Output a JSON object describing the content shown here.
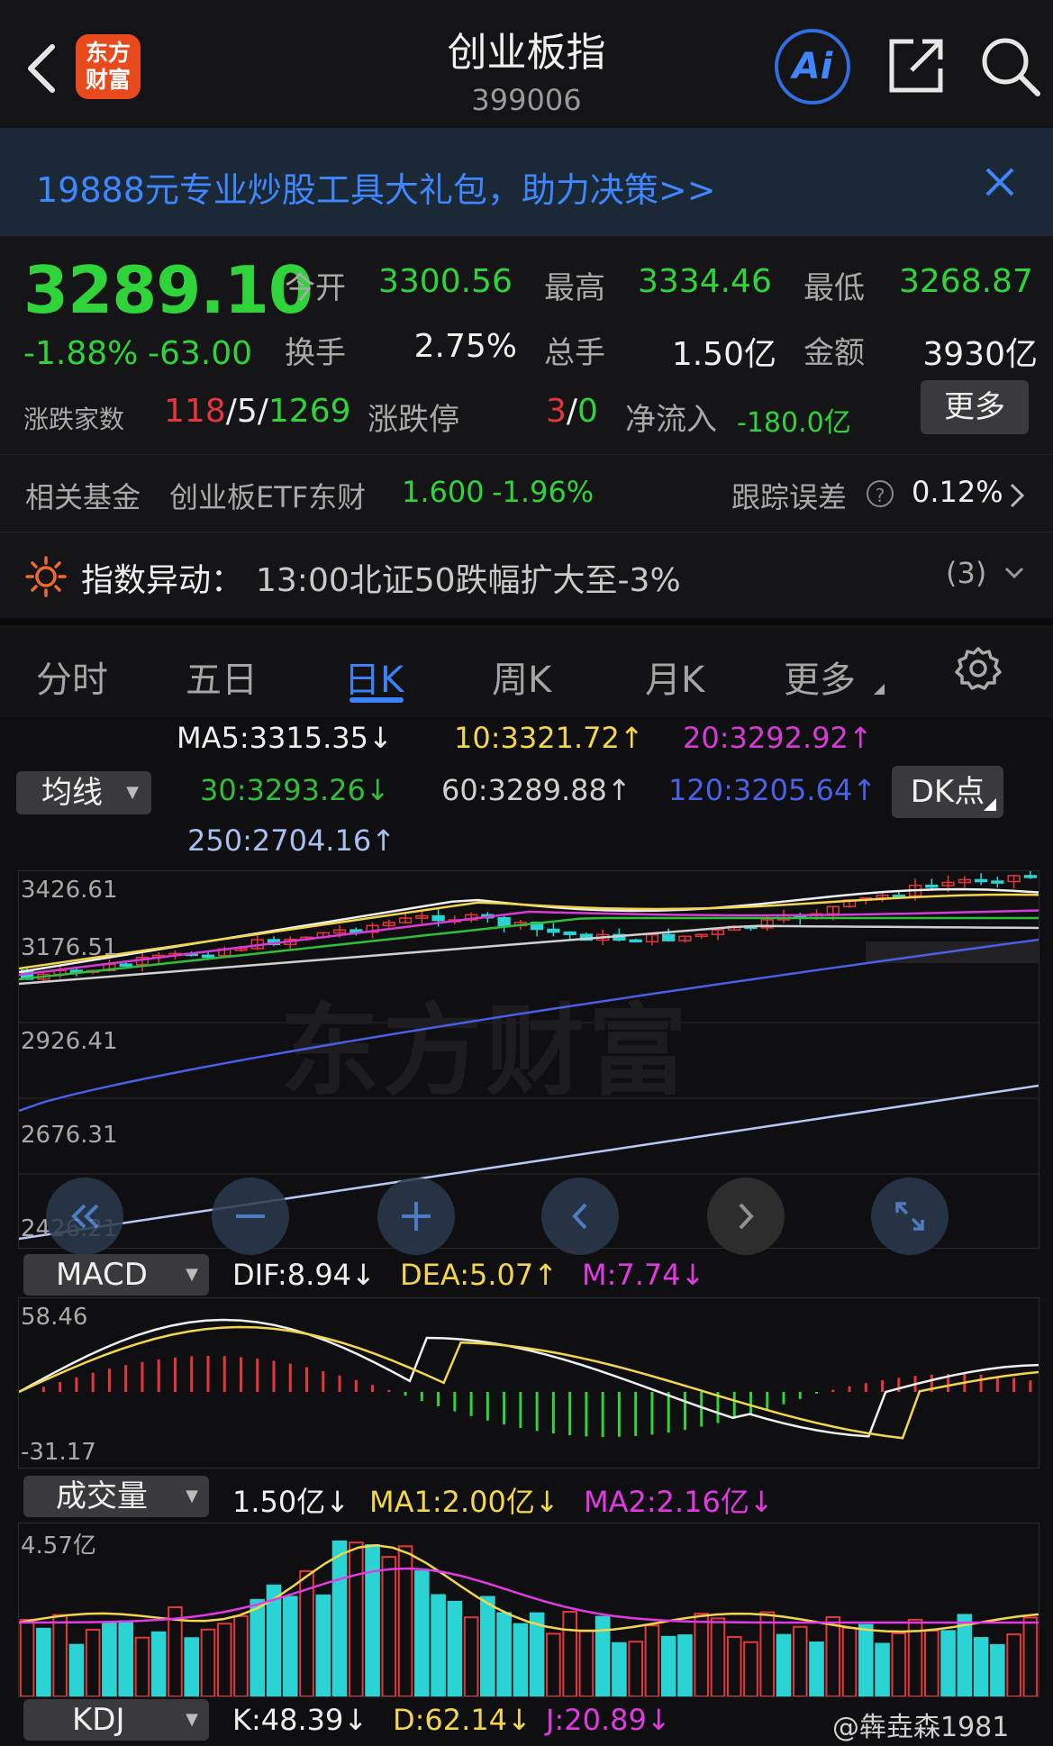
{
  "header": {
    "title": "创业板指",
    "code": "399006",
    "logo_top": "东方",
    "logo_bottom": "财富",
    "ai_label": "Ai"
  },
  "banner": {
    "text": "19888元专业炒股工具大礼包，助力决策>>"
  },
  "quote": {
    "price": "3289.10",
    "change_pct": "-1.88%",
    "change": "-63.00",
    "open_label": "今开",
    "open": "3300.56",
    "high_label": "最高",
    "high": "3334.46",
    "low_label": "最低",
    "low": "3268.87",
    "turnover_label": "换手",
    "turnover": "2.75%",
    "volume_label": "总手",
    "volume": "1.50亿",
    "amount_label": "金额",
    "amount": "3930亿",
    "breadth_label": "涨跌家数",
    "breadth_up": "118",
    "breadth_sep1": "/",
    "breadth_flat": "5",
    "breadth_sep2": "/",
    "breadth_down": "1269",
    "limit_label": "涨跌停",
    "limit_up": "3",
    "limit_sep": "/",
    "limit_down": "0",
    "netflow_label": "净流入",
    "netflow": "-180.0亿",
    "more": "更多"
  },
  "fund": {
    "label": "相关基金",
    "name": "创业板ETF东财",
    "price": "1.600",
    "pct": "-1.96%",
    "track_label": "跟踪误差",
    "track_value": "0.12%"
  },
  "alert": {
    "label": "指数异动：",
    "text": "13:00北证50跌幅扩大至-3%",
    "count": "(3)"
  },
  "tabs": [
    {
      "label": "分时"
    },
    {
      "label": "五日"
    },
    {
      "label": "日K"
    },
    {
      "label": "周K"
    },
    {
      "label": "月K"
    },
    {
      "label": "更多"
    }
  ],
  "ma": {
    "selector": "均线",
    "dk": "DK点",
    "ma5": "MA5:3315.35↓",
    "ma10": "10:3321.72↑",
    "ma20": "20:3292.92↑",
    "ma30": "30:3293.26↓",
    "ma60": "60:3289.88↑",
    "ma120": "120:3205.64↑",
    "ma250": "250:2704.16↑"
  },
  "kline": {
    "y_ticks": [
      "3426.61",
      "3176.51",
      "2926.41",
      "2676.31",
      "2426.21"
    ],
    "watermark": "东方财富"
  },
  "macd": {
    "selector": "MACD",
    "dif": "DIF:8.94↓",
    "dea": "DEA:5.07↑",
    "m": "M:7.74↓",
    "y_top": "58.46",
    "y_bottom": "-31.17"
  },
  "volume": {
    "selector": "成交量",
    "val": "1.50亿↓",
    "ma1": "MA1:2.00亿↓",
    "ma2": "MA2:2.16亿↓",
    "y_top": "4.57亿"
  },
  "kdj": {
    "selector": "KDJ",
    "k": "K:48.39↓",
    "d": "D:62.14↓",
    "j": "J:20.89↓"
  },
  "watermark_user": "@犇垚森1981",
  "colors": {
    "up": "#e5363b",
    "down": "#2fd33a",
    "accent": "#3b82f6",
    "bg": "#0f0f11"
  }
}
